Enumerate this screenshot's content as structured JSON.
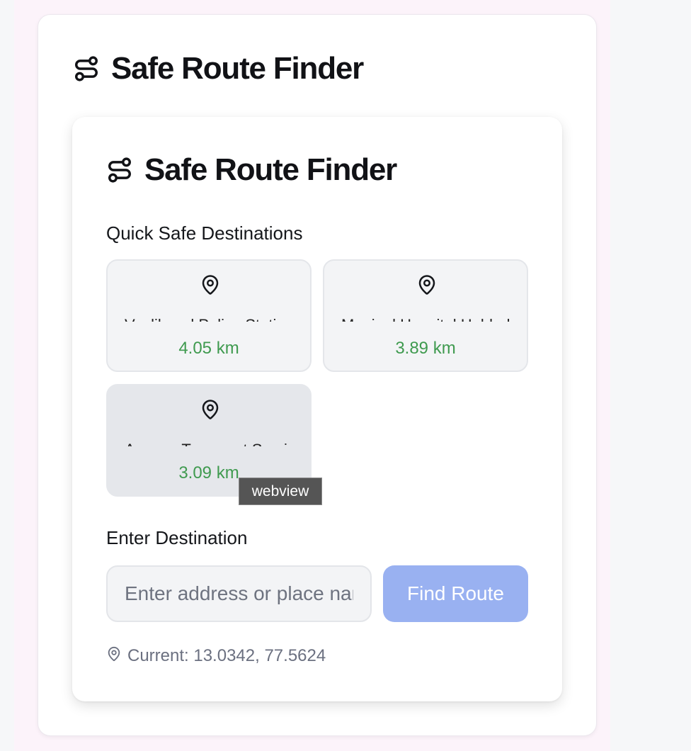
{
  "app": {
    "outer_title": "Safe Route Finder",
    "inner_title": "Safe Route Finder"
  },
  "quick": {
    "label": "Quick Safe Destinations",
    "items": [
      {
        "name": "Vyalikaval Police Station",
        "distance": "4.05 km"
      },
      {
        "name": "Manipal Hospital Hebbal",
        "distance": "3.89 km"
      },
      {
        "name": "Ananya Transport Services",
        "distance": "3.09 km"
      }
    ]
  },
  "tooltip": {
    "text": "webview"
  },
  "destination": {
    "label": "Enter Destination",
    "placeholder": "Enter address or place name",
    "value": ""
  },
  "find_button": {
    "label": "Find Route",
    "color": "#99b1f1"
  },
  "location": {
    "current": "Current: 13.0342, 77.5624"
  },
  "colors": {
    "distance": "#3f9a4f",
    "title": "#111216",
    "muted": "#6b7080"
  },
  "icons": {
    "title": "route-icon",
    "destination": "map-pin-icon",
    "location": "map-pin-icon"
  }
}
